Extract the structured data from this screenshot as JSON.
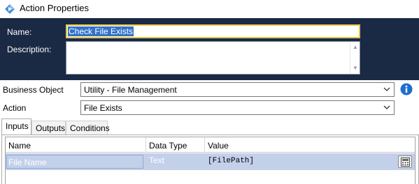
{
  "window": {
    "title": "Action Properties"
  },
  "header": {
    "name_label": "Name:",
    "name_value": "Check File Exists",
    "description_label": "Description:",
    "description_value": ""
  },
  "form": {
    "business_object_label": "Business Object",
    "business_object_value": "Utility - File Management",
    "action_label": "Action",
    "action_value": "File Exists"
  },
  "tabs": [
    {
      "label": "Inputs",
      "active": true
    },
    {
      "label": "Outputs",
      "active": false
    },
    {
      "label": "Conditions",
      "active": false
    }
  ],
  "grid": {
    "columns": [
      "Name",
      "Data Type",
      "Value"
    ],
    "rows": [
      {
        "name": "File Name",
        "data_type": "Text",
        "value": "[FilePath]"
      }
    ]
  },
  "icons": {
    "app": "blue-diamond-icon",
    "info": "info-icon",
    "calculator": "calculator-icon",
    "dropdown": "chevron-down-icon"
  },
  "colors": {
    "header_bg": "#1b2a44",
    "focus_border": "#e8c44a",
    "selection": "#3272c8",
    "row_highlight": "#c3d0ea",
    "info_blue": "#1c6fce"
  }
}
